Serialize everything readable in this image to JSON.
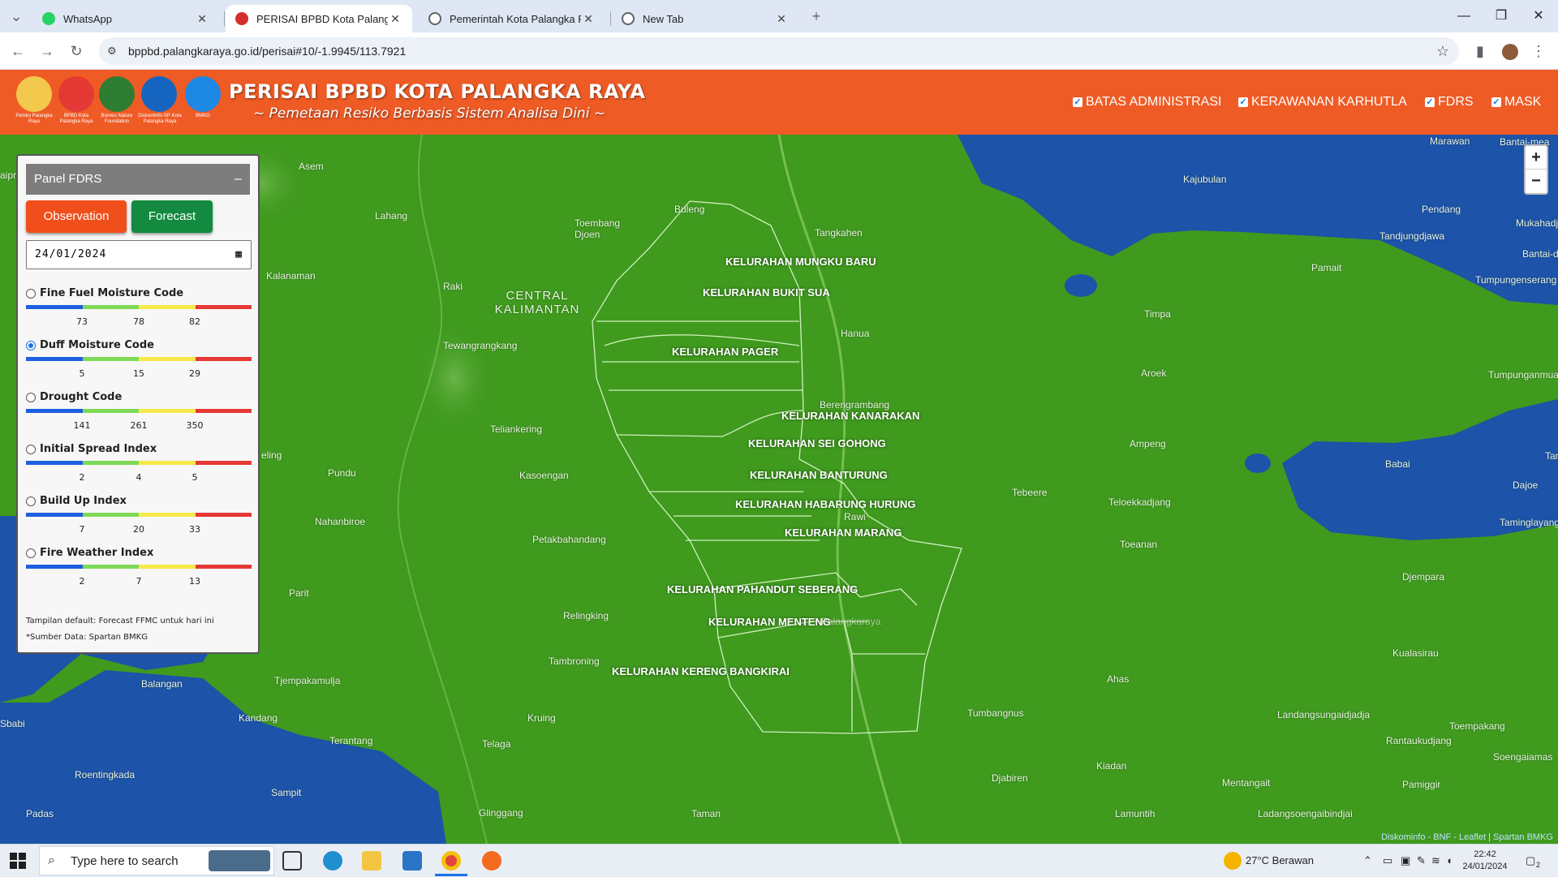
{
  "browser": {
    "tabs": [
      {
        "title": "WhatsApp",
        "icon": "whatsapp-icon",
        "color": "#25d366"
      },
      {
        "title": "PERISAI BPBD Kota Palangka Ra",
        "icon": "bpbd-icon",
        "color": "#d32f2f"
      },
      {
        "title": "Pemerintah Kota Palangka Raya",
        "icon": "globe-icon",
        "color": "#5f6368"
      },
      {
        "title": "New Tab",
        "icon": "chrome-icon",
        "color": "#5f6368"
      }
    ],
    "url": "bppbd.palangkaraya.go.id/perisai#10/-1.9945/113.7921"
  },
  "header": {
    "title": "PERISAI BPBD KOTA PALANGKA RAYA",
    "subtitle": "~ Pemetaan Resiko Berbasis Sistem Analisa Dini ~",
    "logos": [
      {
        "caption": "Pemko Palangka Raya",
        "color": "#f2c94c"
      },
      {
        "caption": "BPBD Kota Palangka Raya",
        "color": "#e53935"
      },
      {
        "caption": "Borneo Nature Foundation",
        "color": "#2e7d32"
      },
      {
        "caption": "Diskominfo-SP Kota Palangka Raya",
        "color": "#1565c0"
      },
      {
        "caption": "BMKG",
        "color": "#1e88e5"
      }
    ],
    "layers": [
      {
        "label": "BATAS ADMINISTRASI",
        "checked": true
      },
      {
        "label": "KERAWANAN KARHUTLA",
        "checked": true
      },
      {
        "label": "FDRS",
        "checked": true
      },
      {
        "label": "MASK",
        "checked": true
      }
    ]
  },
  "panel": {
    "title": "Panel FDRS",
    "collapse": "–",
    "observation_label": "Observation",
    "forecast_label": "Forecast",
    "date_value": "24/01/2024",
    "scale_colors": [
      "#1e5fe0",
      "#7ed957",
      "#f5e94a",
      "#e53935"
    ],
    "indices": [
      {
        "name": "Fine Fuel Moisture Code",
        "selected": false,
        "ticks": [
          "73",
          "78",
          "82"
        ]
      },
      {
        "name": "Duff Moisture Code",
        "selected": true,
        "ticks": [
          "5",
          "15",
          "29"
        ]
      },
      {
        "name": "Drought Code",
        "selected": false,
        "ticks": [
          "141",
          "261",
          "350"
        ]
      },
      {
        "name": "Initial Spread Index",
        "selected": false,
        "ticks": [
          "2",
          "4",
          "5"
        ]
      },
      {
        "name": "Build Up Index",
        "selected": false,
        "ticks": [
          "7",
          "20",
          "33"
        ]
      },
      {
        "name": "Fire Weather Index",
        "selected": false,
        "ticks": [
          "2",
          "7",
          "13"
        ]
      }
    ],
    "note_default": "Tampilan default: Forecast FFMC untuk hari ini",
    "note_source": "*Sumber Data: Spartan BMKG"
  },
  "map": {
    "region_label": [
      "CENTRAL",
      "KALIMANTAN"
    ],
    "kelurahan": [
      "KELURAHAN MUNGKU BARU",
      "KELURAHAN BUKIT SUA",
      "KELURAHAN PAGER",
      "KELURAHAN KANARAKAN",
      "KELURAHAN SEI GOHONG",
      "KELURAHAN BANTURUNG",
      "KELURAHAN HABARUNG HURUNG",
      "KELURAHAN MARANG",
      "KELURAHAN PAHANDUT SEBERANG",
      "KELURAHAN MENTENG",
      "KELURAHAN KERENG BANGKIRAI"
    ],
    "places": [
      "Asem",
      "Buleng",
      "Lahang",
      "Toembang Djoen",
      "Tangkahen",
      "Kalanaman",
      "Raki",
      "Tewangrangkang",
      "Hanua",
      "Berengrambang",
      "Marawan",
      "Bantai-mea",
      "Kajubulan",
      "Pendang",
      "Mukahadji",
      "Tandjungdjawa",
      "Bantai-djau",
      "Pamait",
      "Tumpungenserang",
      "Timpa",
      "Aroek",
      "Tumpunganmuar",
      "Teliankering",
      "Ampeng",
      "Babai",
      "Tan",
      "Dajoe",
      "Pundu",
      "Kasoengan",
      "Tebeere",
      "Teloekkadjang",
      "Taminglayang",
      "Nahanbiroe",
      "Petakbahandang",
      "Rawi",
      "Toeanan",
      "Djempara",
      "Parit",
      "Relingking",
      "Palangkaraya",
      "Kualasirau",
      "Balangan",
      "Tjempakamulja",
      "Tambroning",
      "Ahas",
      "Sbabi",
      "Kandang",
      "Kruing",
      "Tumbangnus",
      "Landangsungaidjadja",
      "Toempakang",
      "Terantang",
      "Telaga",
      "Rantaukudjang",
      "Soengaiamas",
      "Roentingkada",
      "Kiadan",
      "Djabiren",
      "Mentangait",
      "Pamiggir",
      "Sampit",
      "Padas",
      "Glinggang",
      "Taman",
      "Lamuntih",
      "Ladangsoengaibindjai",
      "eling",
      "aipri"
    ],
    "zoom_in": "+",
    "zoom_out": "−",
    "attribution": "Diskominfo - BNF - Leaflet | Spartan BMKG",
    "land_color": "#3f9a1e",
    "water_color": "#1d53a8"
  },
  "taskbar": {
    "search_placeholder": "Type here to search",
    "weather": "27°C  Berawan",
    "time": "22:42",
    "date": "24/01/2024",
    "notifications": "2"
  }
}
